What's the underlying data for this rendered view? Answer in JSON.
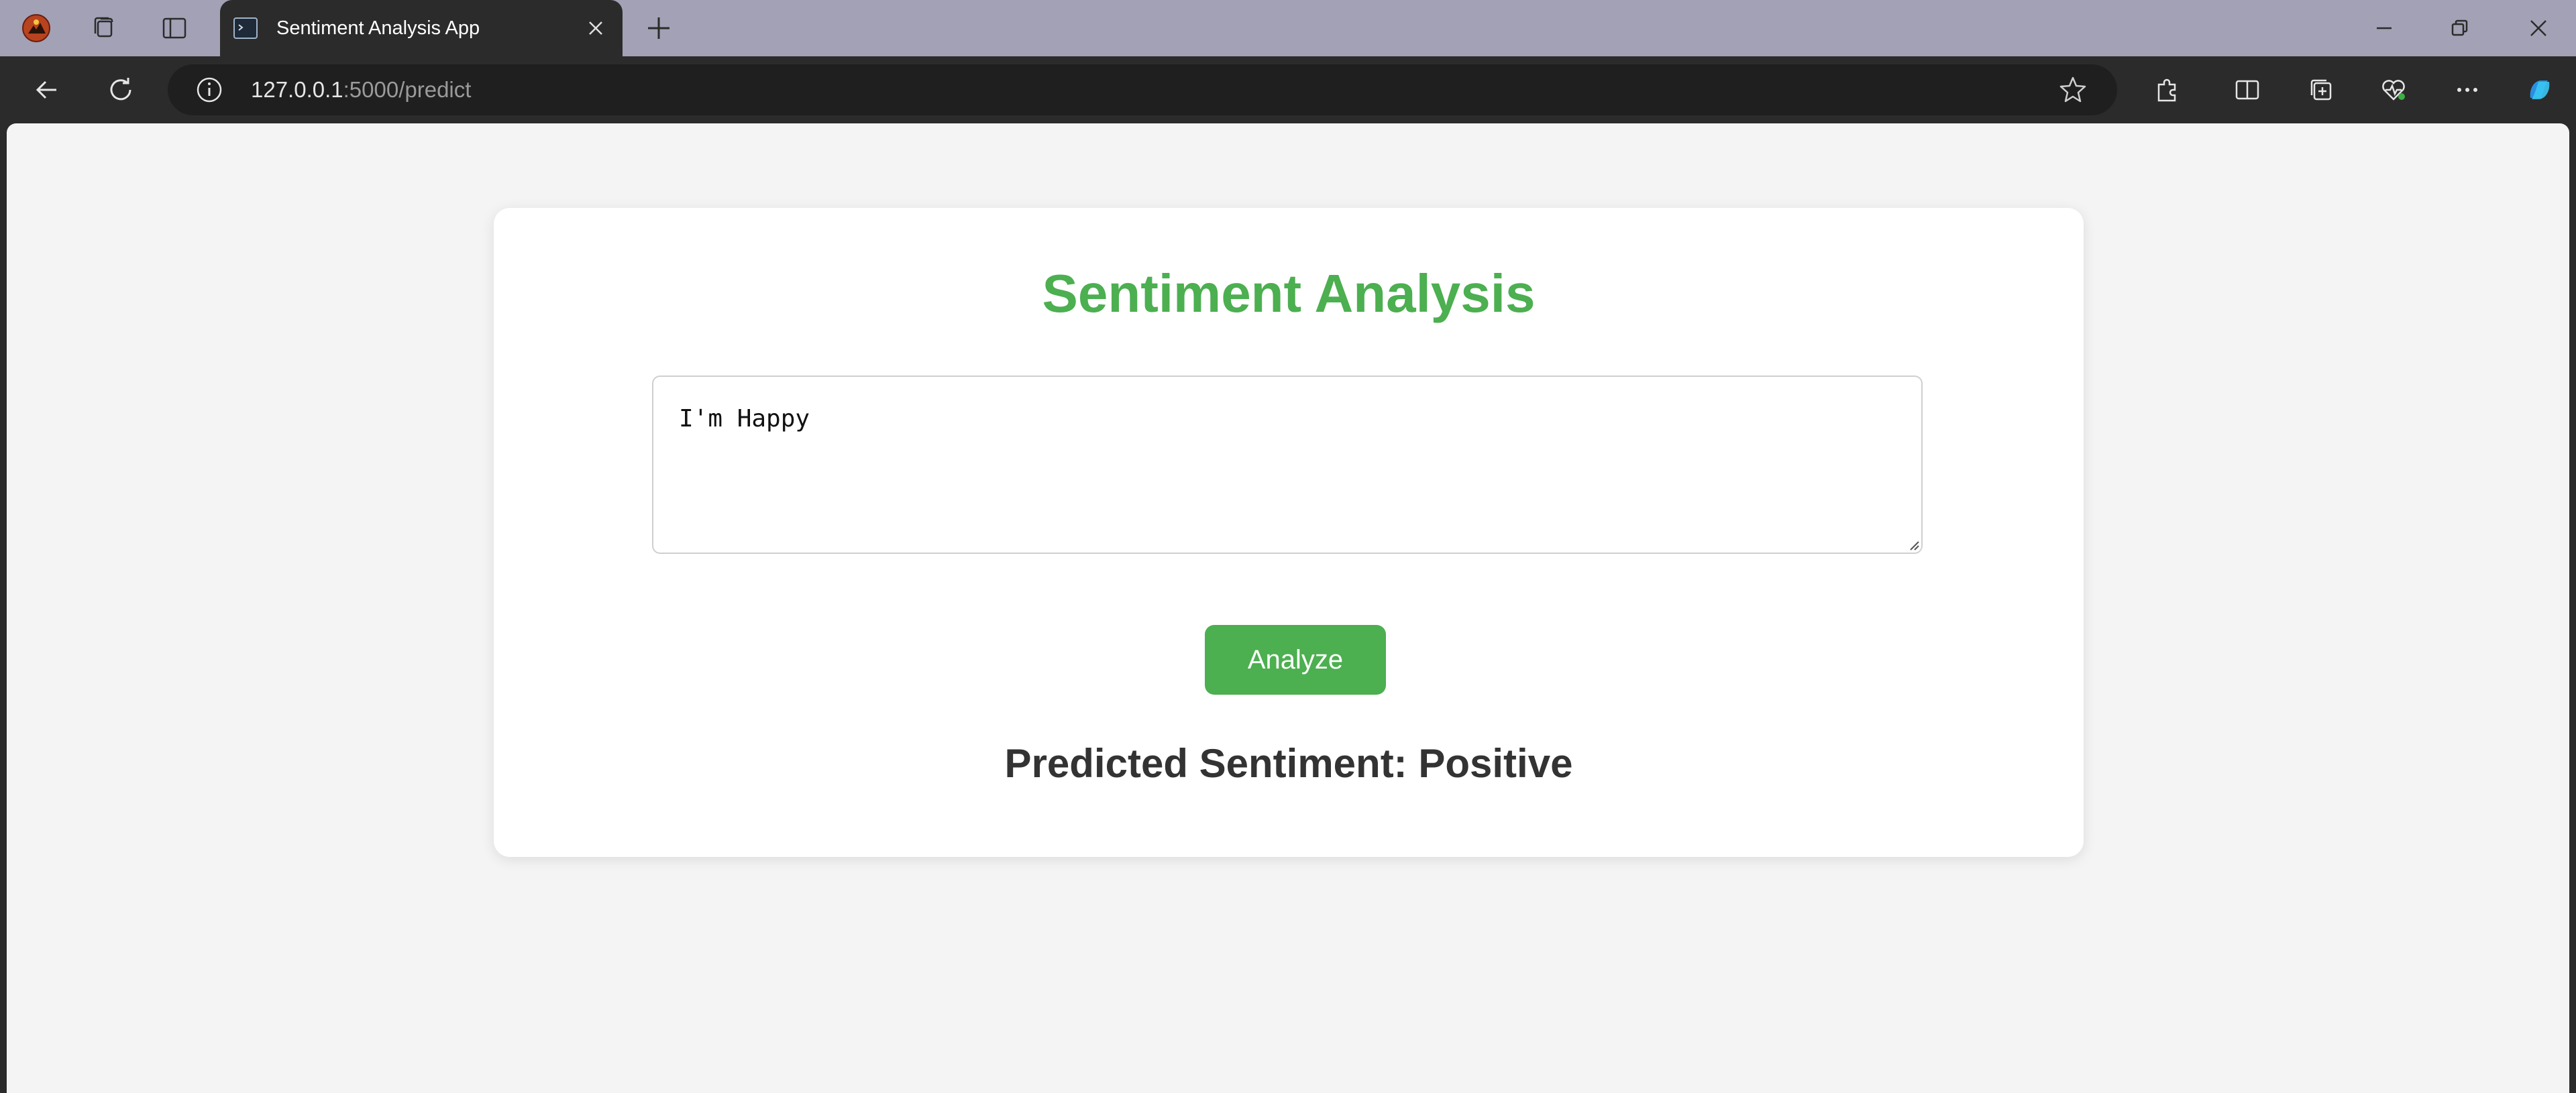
{
  "browser": {
    "tab_title": "Sentiment Analysis App",
    "url_host": "127.0.0.1",
    "url_path": ":5000/predict",
    "icons": [
      "profile-avatar-icon",
      "workspaces-icon",
      "vertical-tabs-icon",
      "app-favicon",
      "close-icon",
      "new-tab-icon",
      "minimize-icon",
      "restore-icon",
      "window-close-icon",
      "back-icon",
      "refresh-icon",
      "site-info-icon",
      "favorite-star-icon",
      "extensions-icon",
      "split-screen-icon",
      "collections-icon",
      "browser-essentials-icon",
      "more-icon",
      "copilot-icon"
    ]
  },
  "page": {
    "title": "Sentiment Analysis",
    "input_text": "I'm Happy",
    "analyze_label": "Analyze",
    "result": "Predicted Sentiment: Positive",
    "accent_color": "#4caf50",
    "background_color": "#f4f4f4"
  }
}
